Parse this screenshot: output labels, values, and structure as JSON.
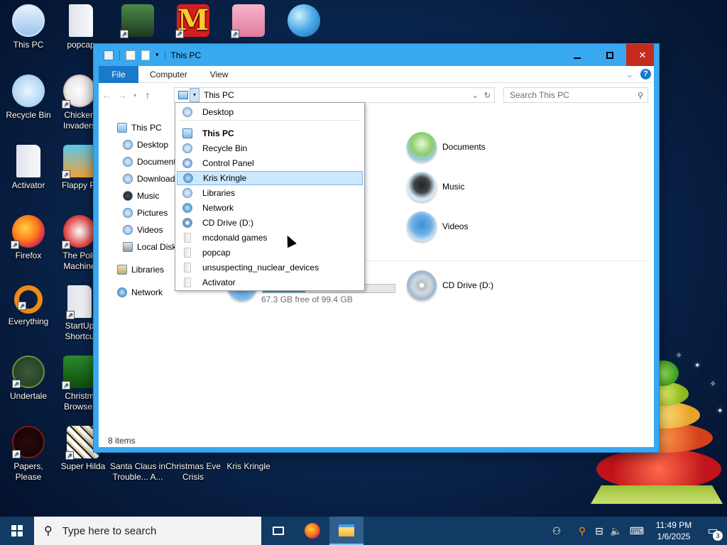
{
  "desktop": {
    "icons": [
      {
        "label": "This PC",
        "icon": "computer-icon"
      },
      {
        "label": "popcap",
        "icon": "folder-icon"
      },
      {
        "label": "",
        "icon": "character-game-icon"
      },
      {
        "label": "",
        "icon": "mcdonalds-icon"
      },
      {
        "label": "",
        "icon": "pig-game-icon"
      },
      {
        "label": "",
        "icon": "internet-explorer-icon"
      },
      {
        "label": "Recycle Bin",
        "icon": "recycle-bin-icon"
      },
      {
        "label": "Chicken Invaders",
        "icon": "chicken-invaders-icon"
      },
      {
        "label": "Activator",
        "icon": "folder-icon"
      },
      {
        "label": "Flappy Pl",
        "icon": "flappy-icon"
      },
      {
        "label": "Firefox",
        "icon": "firefox-icon"
      },
      {
        "label": "The Polit Machine",
        "icon": "politics-icon"
      },
      {
        "label": "Everything",
        "icon": "everything-icon"
      },
      {
        "label": "StartUp Shortcu",
        "icon": "folder-icon"
      },
      {
        "label": "Undertale",
        "icon": "undertale-icon"
      },
      {
        "label": "Christm Browser",
        "icon": "christmas-browser-icon"
      },
      {
        "label": "Papers, Please",
        "icon": "papers-please-icon"
      },
      {
        "label": "Super Hilda",
        "icon": "super-hilda-icon"
      },
      {
        "label": "Santa Claus in Trouble... A...",
        "icon": "santa-icon"
      },
      {
        "label": "Christmas Eve Crisis",
        "icon": "christmas-eve-icon"
      },
      {
        "label": "Kris Kringle",
        "icon": "kris-kringle-icon"
      }
    ]
  },
  "explorer": {
    "title": "This PC",
    "ribbon_tabs": [
      "File",
      "Computer",
      "View"
    ],
    "address_path": "This PC",
    "search_placeholder": "Search This PC",
    "nav_pane": [
      "This PC",
      "Desktop",
      "Document",
      "Download",
      "Music",
      "Pictures",
      "Videos",
      "Local Disk",
      "Libraries",
      "Network"
    ],
    "content": {
      "documents": "Documents",
      "music": "Music",
      "videos": "Videos",
      "cd_drive": "CD Drive (D:)",
      "disk_free_text": "67.3 GB free of 99.4 GB",
      "disk_used_fraction": 0.323
    },
    "status": "8 items",
    "address_dropdown": [
      {
        "label": "Desktop",
        "icon": "desktop-icon"
      },
      {
        "label": "This PC",
        "icon": "this-pc-icon",
        "bold": true
      },
      {
        "label": "Recycle Bin",
        "icon": "recycle-bin-icon"
      },
      {
        "label": "Control Panel",
        "icon": "control-panel-icon"
      },
      {
        "label": "Kris Kringle",
        "icon": "kris-kringle-icon",
        "selected": true
      },
      {
        "label": "Libraries",
        "icon": "libraries-icon"
      },
      {
        "label": "Network",
        "icon": "network-icon"
      },
      {
        "label": "CD Drive (D:)",
        "icon": "cd-drive-icon"
      },
      {
        "label": "mcdonald games",
        "icon": "folder-icon"
      },
      {
        "label": "popcap",
        "icon": "folder-icon"
      },
      {
        "label": "unsuspecting_nuclear_devices",
        "icon": "folder-icon"
      },
      {
        "label": "Activator",
        "icon": "folder-icon"
      }
    ]
  },
  "taskbar": {
    "search_placeholder": "Type here to search",
    "time": "11:49 PM",
    "date": "1/6/2025",
    "notification_count": "3"
  }
}
